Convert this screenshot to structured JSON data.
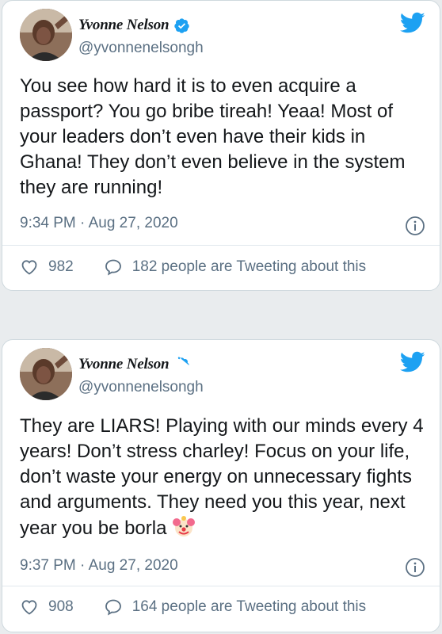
{
  "tweets": [
    {
      "author": {
        "display_name": "Yvonne Nelson",
        "handle": "@yvonnenelsongh",
        "verified": true
      },
      "text": "You see how hard it is to even acquire a passport? You go bribe tireah! Yeaa! Most of your leaders don’t even have their kids in Ghana! They don’t even believe in the system they are running!",
      "timestamp": "9:34 PM · Aug 27, 2020",
      "likes": "982",
      "conversation": "182 people are Tweeting about this"
    },
    {
      "author": {
        "display_name": "Yvonne Nelson",
        "handle": "@yvonnenelsongh",
        "verified": true
      },
      "text": "They are LIARS! Playing with our minds every 4 years! Don’t stress charley! Focus on your life, don’t waste your energy on unnecessary fights and arguments. They need you this year, next year you be borla",
      "text_emoji": "clown-face-emoji",
      "timestamp": "9:37 PM · Aug 27, 2020",
      "likes": "908",
      "conversation": "164 people are Tweeting about this"
    }
  ],
  "colors": {
    "twitter_blue": "#1da1f2",
    "secondary_text": "#5b7083",
    "card_border": "#cfd9de"
  },
  "icons": [
    "twitter-bird-icon",
    "verified-badge-icon",
    "info-icon",
    "heart-icon",
    "speech-bubble-icon"
  ]
}
